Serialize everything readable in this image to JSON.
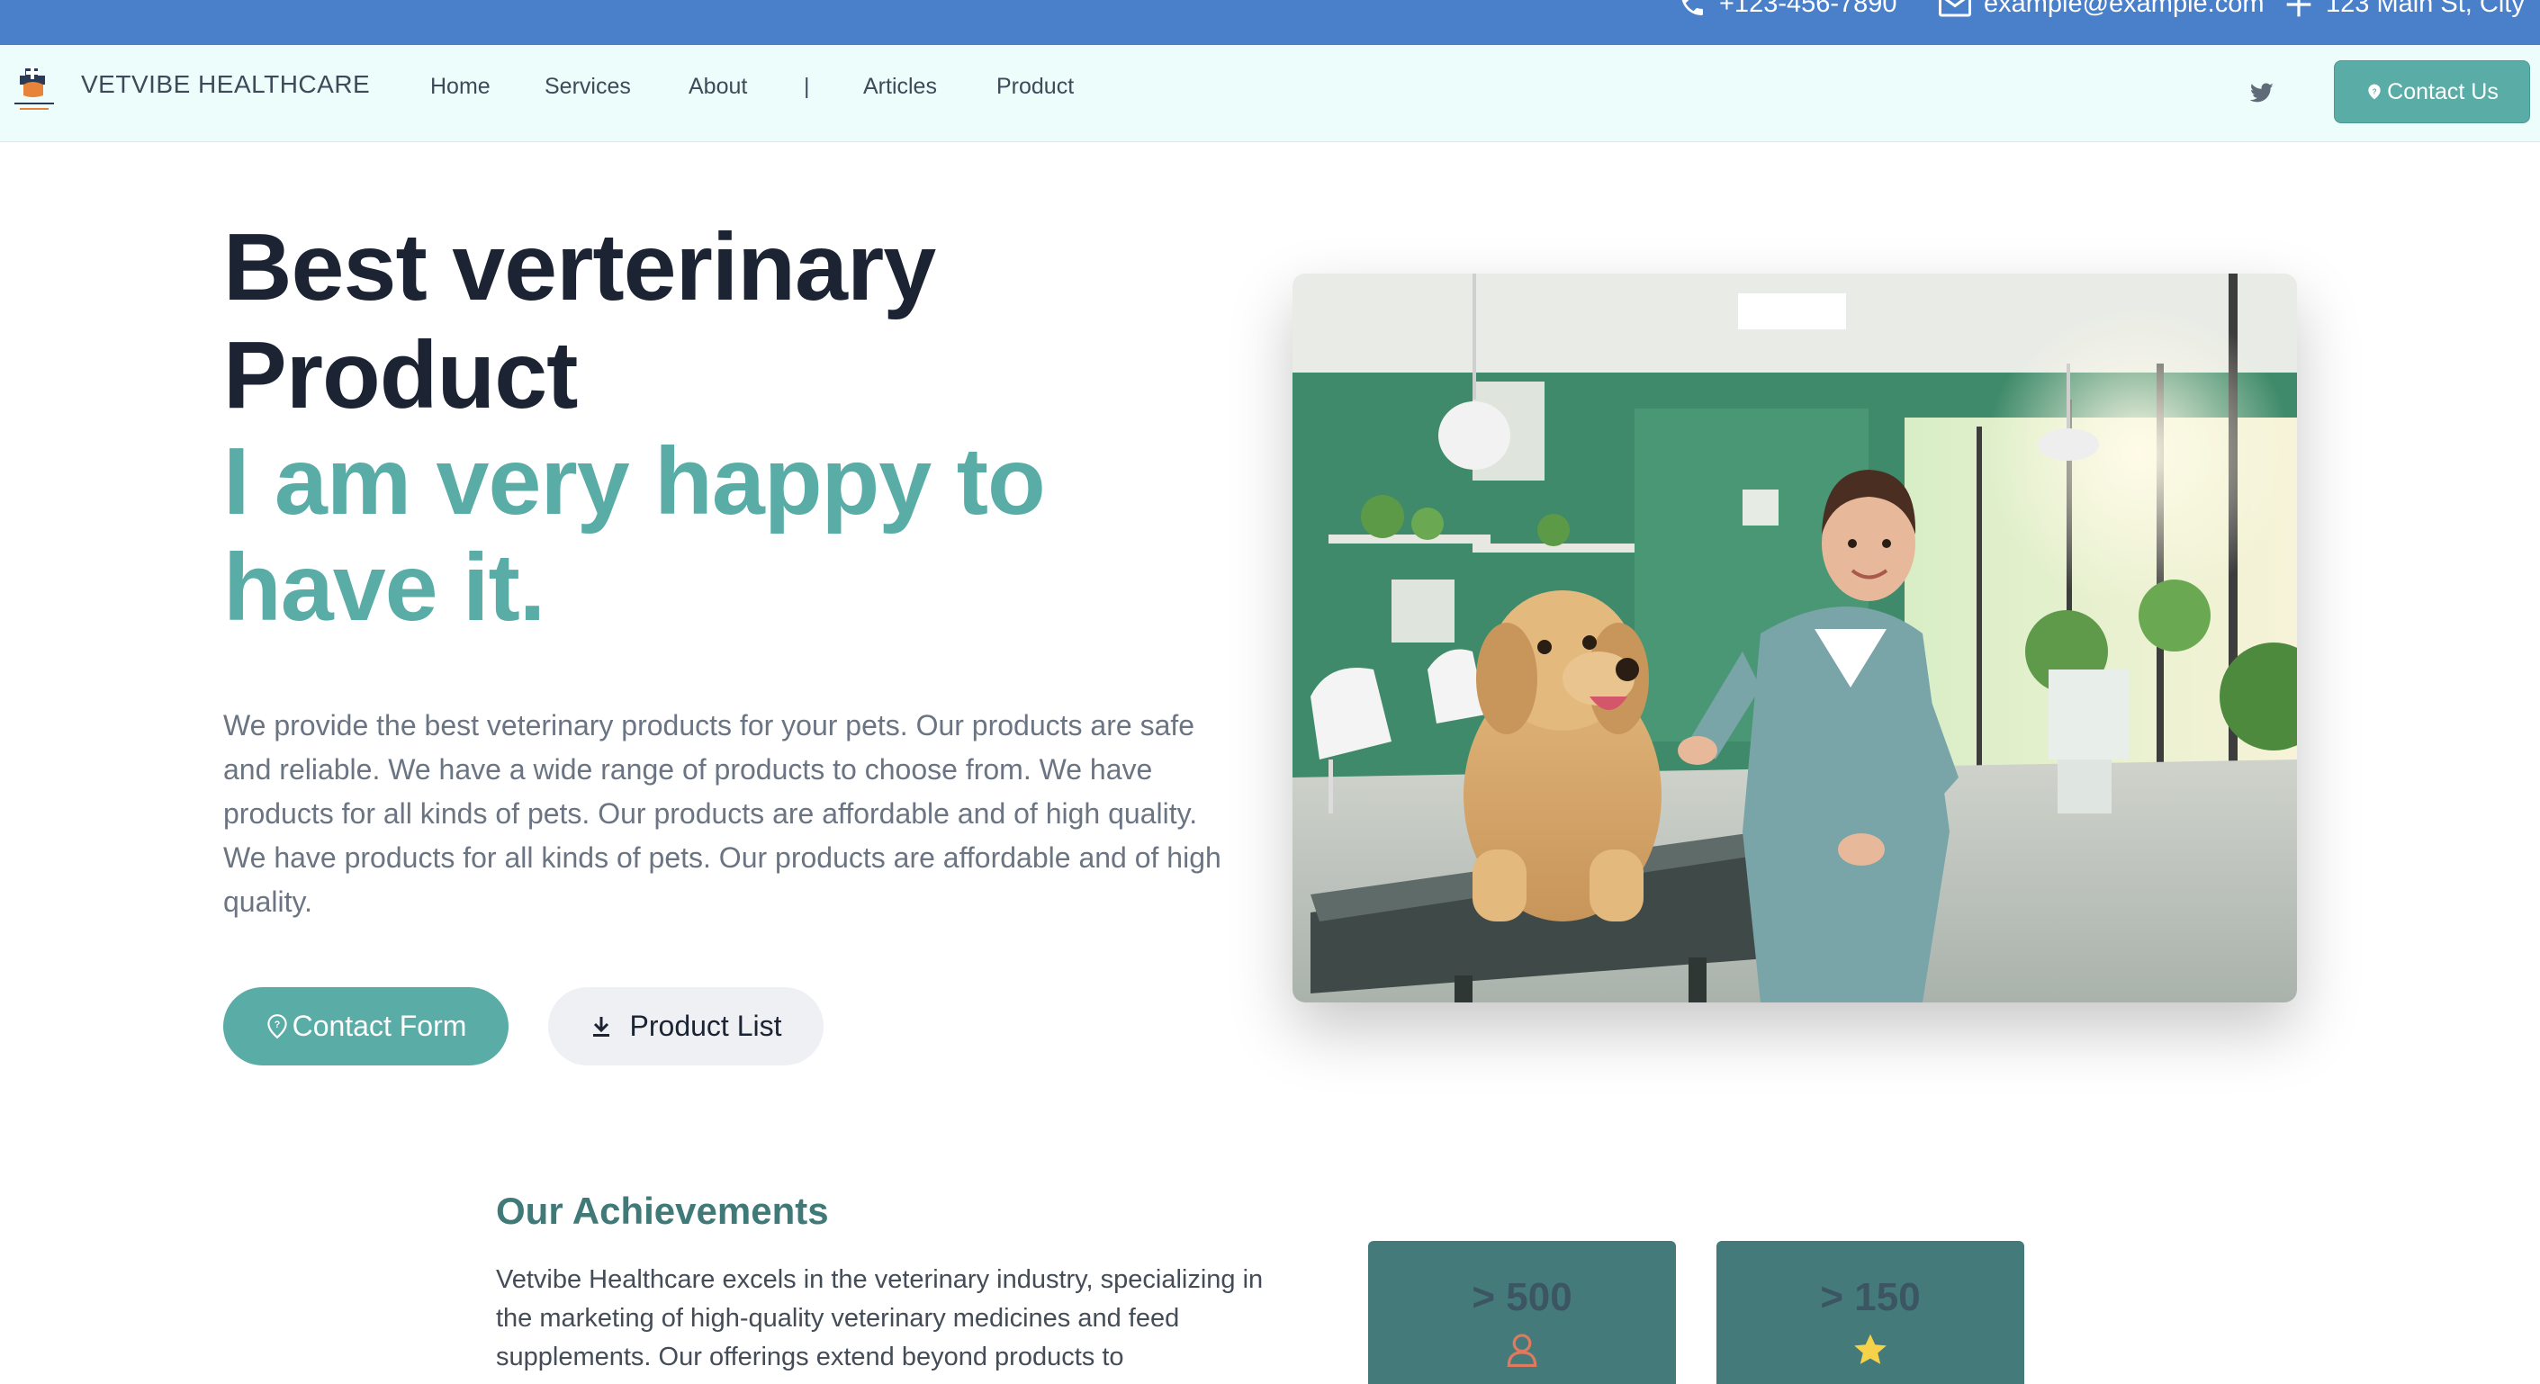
{
  "topbar": {
    "phone": "+123-456-7890",
    "email": "example@example.com",
    "address": "123 Main St, City"
  },
  "navbar": {
    "brand": "VETVIBE HEALTHCARE",
    "links": [
      "Home",
      "Services",
      "About",
      "|",
      "Articles",
      "Product"
    ],
    "contact_button": "Contact Us"
  },
  "hero": {
    "line1": "Best verterinary",
    "line2": "Product",
    "line3": "I am very happy to",
    "line4": "have it.",
    "description": "We provide the best veterinary products for your pets. Our products are safe and reliable. We have a wide range of products to choose from. We have products for all kinds of pets. Our products are affordable and of high quality. We have products for all kinds of pets. Our products are affordable and of high quality.",
    "primary_button": "Contact Form",
    "secondary_button": "Product List"
  },
  "achievements": {
    "title": "Our Achievements",
    "text": "Vetvibe Healthcare excels in the veterinary industry, specializing in the marketing of high-quality veterinary medicines and feed supplements. Our offerings extend beyond products to",
    "stats": [
      {
        "value": "> 500",
        "icon": "user-icon"
      },
      {
        "value": "> 150",
        "icon": "star-icon"
      }
    ]
  },
  "colors": {
    "topbar": "#4a7fc9",
    "navbar": "#edfdfb",
    "accent": "#5aaca6",
    "heading": "#1c2333",
    "stat_card": "#457a7a",
    "user_icon": "#e07a5f",
    "star_icon": "#f6d24a"
  }
}
